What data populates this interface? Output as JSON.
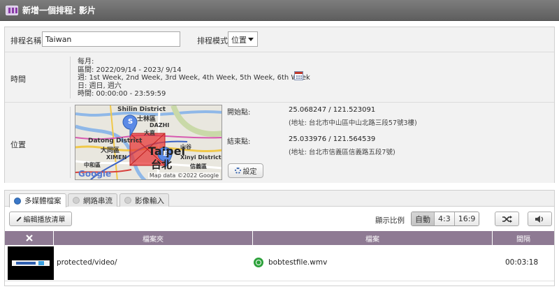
{
  "window": {
    "title": "新增一個排程: 影片"
  },
  "form": {
    "name_label": "排程名稱",
    "name_value": "Taiwan",
    "mode_label": "排程模式",
    "mode_value": "位置"
  },
  "time": {
    "label": "時間",
    "lines": [
      "每月:",
      "區間: 2022/09/14 - 2023/ 9/14",
      "週: 1st Week, 2nd Week, 3rd Week, 4th Week, 5th Week, 6th Week",
      "日: 週日, 週六",
      "時間: 00:00:00 - 23:59:59"
    ]
  },
  "location": {
    "label": "位置",
    "map": {
      "labels": [
        "Shilin District",
        "士林區",
        "DAZHI",
        "大直",
        "Datong District",
        "大同區",
        "Taipei",
        "台北",
        "XIMEN",
        "山谷",
        "Xinyi District",
        "信義區",
        "中和區"
      ],
      "start_marker": "S",
      "end_marker": "E",
      "credit": "Map data ©2022 Google",
      "google": "Google"
    },
    "start_label": "開始點:",
    "start_coord": "25.068247 / 121.523091",
    "start_addr": "(地址: 台北市中山區中山北路三段57號3樓)",
    "end_label": "結束點:",
    "end_coord": "25.033976 / 121.564539",
    "end_addr": "(地址: 台北市信義區信義路五段7號)",
    "settings_label": "設定"
  },
  "tabs": [
    {
      "label": "多媒體檔案",
      "active": true
    },
    {
      "label": "網路串流",
      "active": false
    },
    {
      "label": "影像輸入",
      "active": false
    }
  ],
  "toolbar": {
    "edit_label": "編輯播放清單",
    "ratio_label": "顯示比例",
    "ratio_options": [
      "自動",
      "4:3",
      "16:9"
    ],
    "ratio_selected": "自動"
  },
  "table": {
    "headers": [
      "檔案夾",
      "檔案",
      "間隔"
    ],
    "rows": [
      {
        "folder": "protected/video/",
        "file": "bobtestfile.wmv",
        "interval": "00:03:18"
      }
    ]
  }
}
